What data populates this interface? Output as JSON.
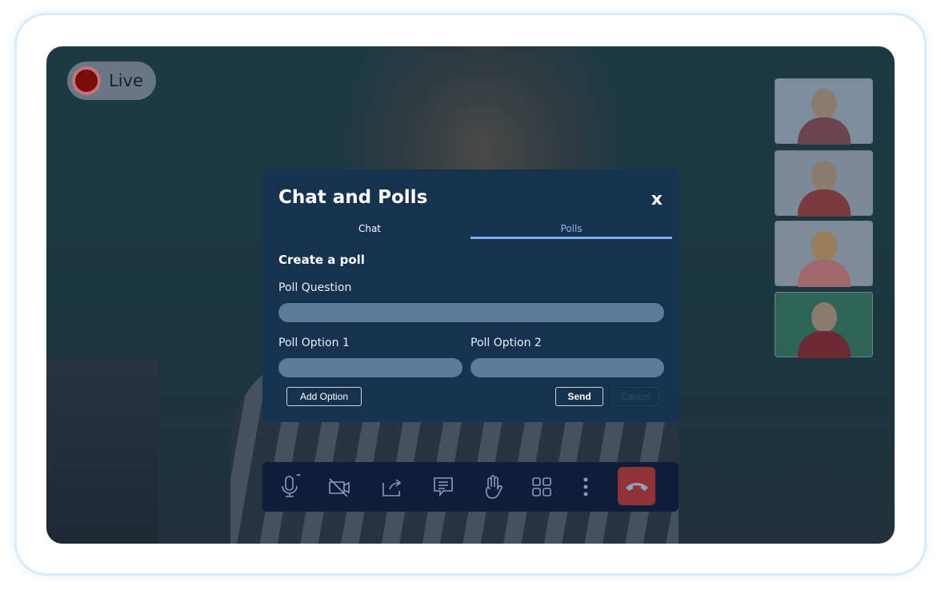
{
  "live_badge": {
    "label": "Live"
  },
  "modal": {
    "title": "Chat and Polls",
    "close_label": "x",
    "tabs": [
      {
        "label": "Chat",
        "active": false
      },
      {
        "label": "Polls",
        "active": true
      }
    ],
    "section_title": "Create a poll",
    "question_label": "Poll Question",
    "option1_label": "Poll Option 1",
    "option2_label": "Poll Option 2",
    "add_option_label": "Add Option",
    "send_label": "Send",
    "cancel_label": "Cancel"
  },
  "toolbar": {
    "icons": [
      "microphone-icon",
      "camera-off-icon",
      "share-screen-icon",
      "chat-icon",
      "raise-hand-icon",
      "grid-view-icon",
      "more-icon",
      "end-call-icon"
    ]
  },
  "colors": {
    "accent": "#7fb0ee",
    "end_call": "#8f3338",
    "modal_bg": "#17324f"
  }
}
